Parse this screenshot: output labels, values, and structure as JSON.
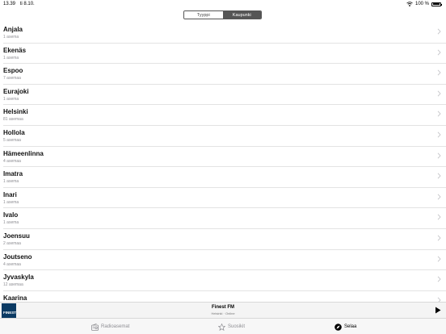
{
  "status_bar": {
    "time": "13.39",
    "date": "ti 8.10.",
    "battery": "100 %"
  },
  "segmented": {
    "options": [
      "Tyyppi",
      "Kaupunki"
    ],
    "selected": "Kaupunki"
  },
  "cities": [
    {
      "name": "Anjala",
      "count": "1 asema"
    },
    {
      "name": "Ekenäs",
      "count": "1 asema"
    },
    {
      "name": "Espoo",
      "count": "7 asemaa"
    },
    {
      "name": "Eurajoki",
      "count": "1 asema"
    },
    {
      "name": "Helsinki",
      "count": "81 asemaa"
    },
    {
      "name": "Hollola",
      "count": "5 asemaa"
    },
    {
      "name": "Hämeenlinna",
      "count": "4 asemaa"
    },
    {
      "name": "Imatra",
      "count": "1 asema"
    },
    {
      "name": "Inari",
      "count": "1 asema"
    },
    {
      "name": "Ivalo",
      "count": "1 asema"
    },
    {
      "name": "Joensuu",
      "count": "2 asemaa"
    },
    {
      "name": "Joutseno",
      "count": "4 asemaa"
    },
    {
      "name": "Jyvaskyla",
      "count": "12 asemaa"
    },
    {
      "name": "Kaarina",
      "count": ""
    }
  ],
  "now_playing": {
    "title": "Finest FM",
    "subtitle": "Helsinki · Online",
    "art_label": "FINEST"
  },
  "tabs": [
    {
      "label": "Radioasemat",
      "icon": "radio-icon",
      "active": false
    },
    {
      "label": "Suosikit",
      "icon": "star-icon",
      "active": false
    },
    {
      "label": "Selaa",
      "icon": "compass-icon",
      "active": true
    }
  ]
}
